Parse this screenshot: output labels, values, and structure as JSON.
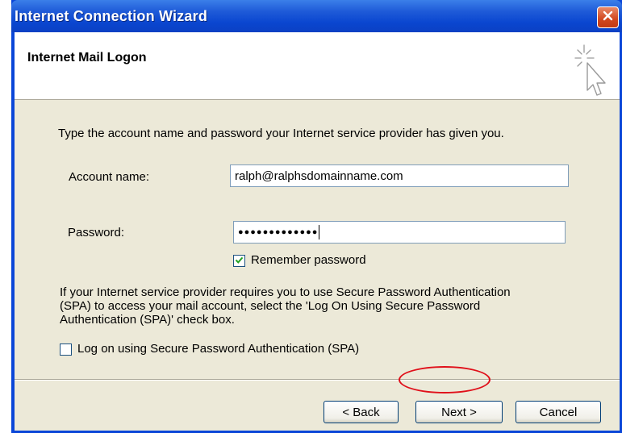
{
  "window": {
    "title": "Internet Connection Wizard"
  },
  "header": {
    "title": "Internet Mail Logon"
  },
  "main": {
    "instruction": "Type the account name and password your Internet service provider has given you.",
    "account_label": "Account name:",
    "account_value": "ralph@ralphsdomainname.com",
    "password_label": "Password:",
    "password_value": "●●●●●●●●●●●●●",
    "remember_label": "Remember password",
    "remember_checked": true,
    "spa_text_line1": "If your Internet service provider requires you to use Secure Password Authentication",
    "spa_text_line2": "(SPA) to access your mail account, select the 'Log On Using Secure Password",
    "spa_text_line3": "Authentication (SPA)' check box.",
    "spa_label": "Log on using Secure Password Authentication (SPA)",
    "spa_checked": false
  },
  "footer": {
    "back_label": "< Back",
    "next_label": "Next >",
    "cancel_label": "Cancel"
  },
  "icons": {
    "close": "close-icon",
    "wizard": "wizard-cursor-icon",
    "check": "check-icon"
  },
  "colors": {
    "titlebar": "#0a46d8",
    "dialog_bg": "#ece9d8",
    "close_button": "#d1471f",
    "highlight": "#e0101a"
  }
}
